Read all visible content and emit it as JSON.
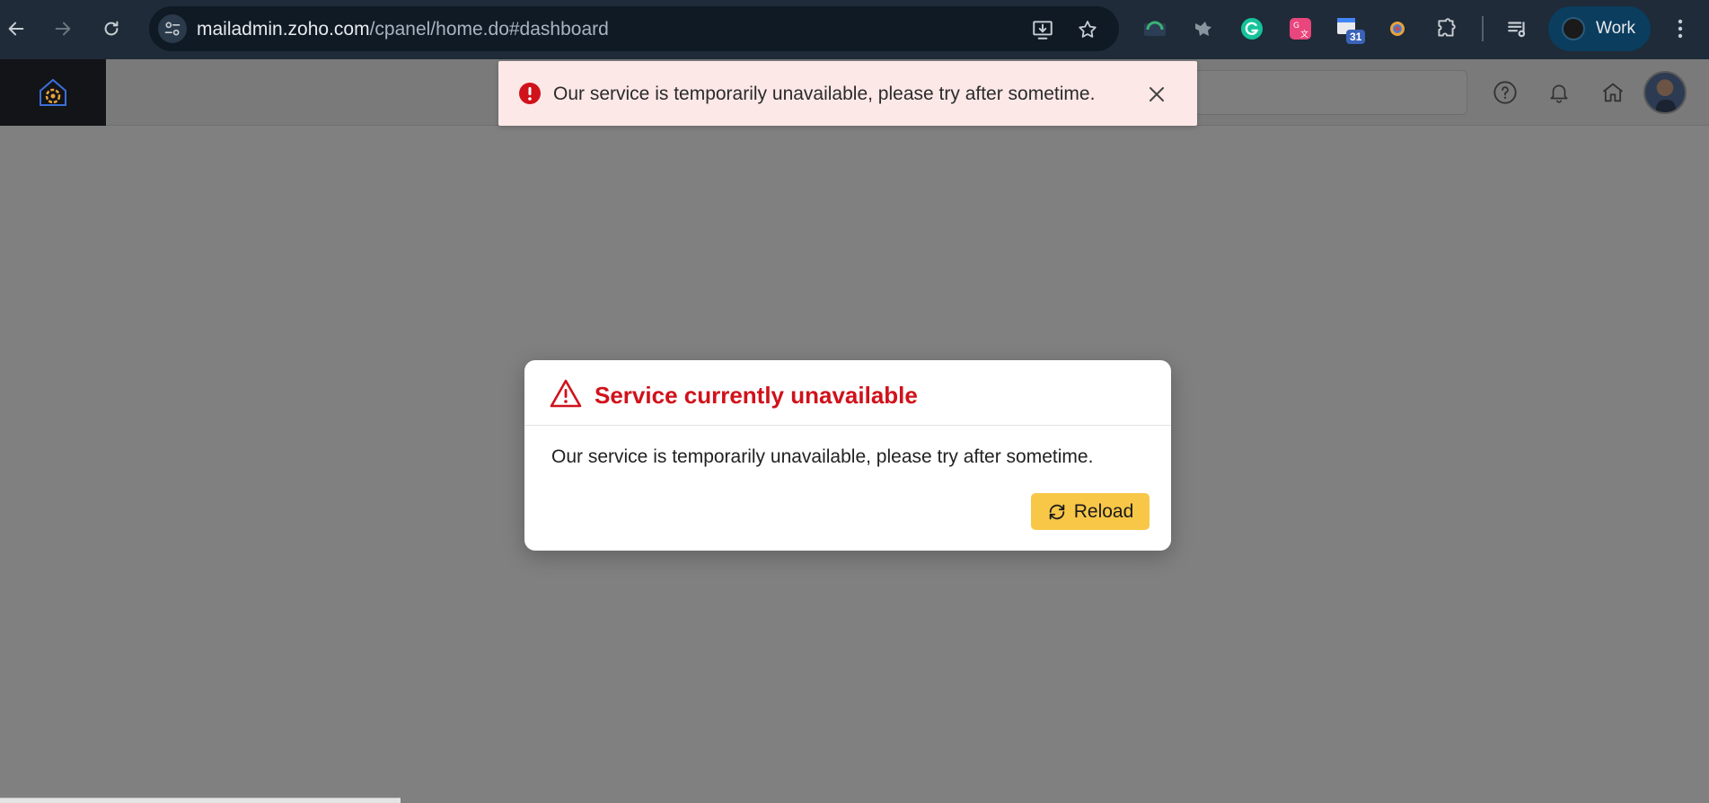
{
  "browser": {
    "url_host": "mailadmin.zoho.com",
    "url_path": "/cpanel/home.do#dashboard",
    "profile_label": "Work",
    "calendar_badge": "31",
    "extensions": [
      "monitor-ext-icon",
      "fox-ext-icon",
      "grammarly-icon",
      "translate-ext-icon",
      "calendar-ext-icon",
      "chromium-ext-icon",
      "puzzle-icon"
    ]
  },
  "toast": {
    "message": "Our service is temporarily unavailable, please try after sometime.",
    "color": "#fde8e8"
  },
  "modal": {
    "title": "Service currently unavailable",
    "message": "Our service is temporarily unavailable, please try after sometime.",
    "reload_label": "Reload",
    "title_color": "#d0121b",
    "button_color": "#f8c748"
  }
}
